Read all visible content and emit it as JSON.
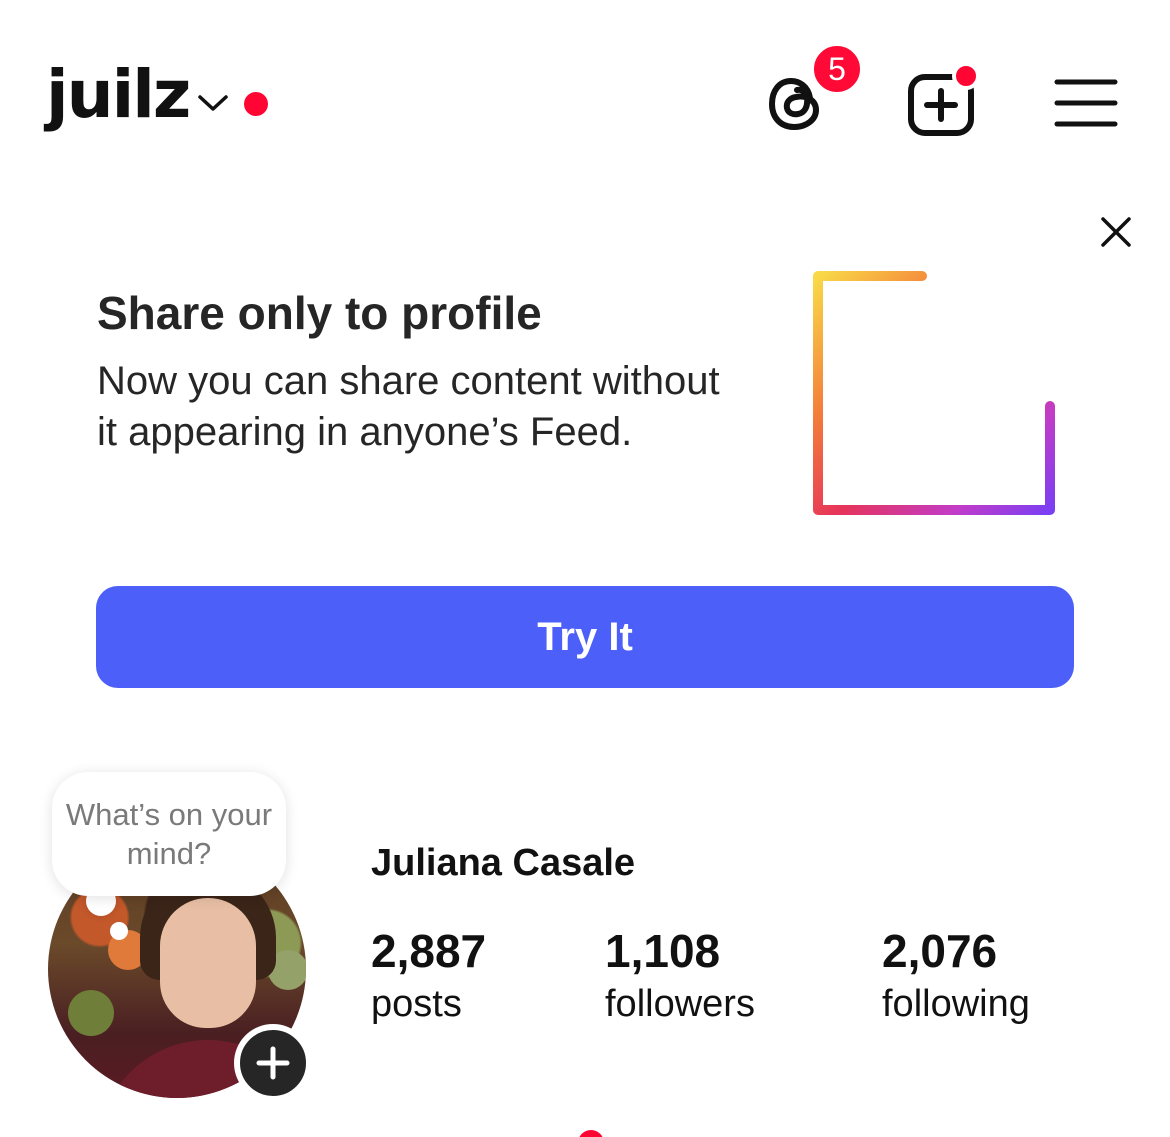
{
  "header": {
    "username": "juilz",
    "threads_badge_count": "5",
    "icons": {
      "switch_account": "chevron-down-icon",
      "threads": "threads-icon",
      "create": "plus-square-icon",
      "menu": "hamburger-menu-icon"
    }
  },
  "promo": {
    "title": "Share only to profile",
    "body": "Now you can share content without it appearing in anyone’s Feed.",
    "button_label": "Try It",
    "close_icon": "close-icon",
    "graphic_icon": "profile-grid-add-icon"
  },
  "profile": {
    "note_placeholder": "What’s on your mind?",
    "full_name": "Juliana Casale",
    "stats": {
      "posts": {
        "value": "2,887",
        "label": "posts"
      },
      "followers": {
        "value": "1,108",
        "label": "followers"
      },
      "following": {
        "value": "2,076",
        "label": "following"
      }
    }
  },
  "colors": {
    "accent_blue": "#4d5ff9",
    "notification_red": "#ff0534",
    "text_dark": "#262626",
    "gradient_stops": [
      "#f9d947",
      "#f37b3a",
      "#e6345a",
      "#c13cc9",
      "#7b3ff2"
    ]
  }
}
